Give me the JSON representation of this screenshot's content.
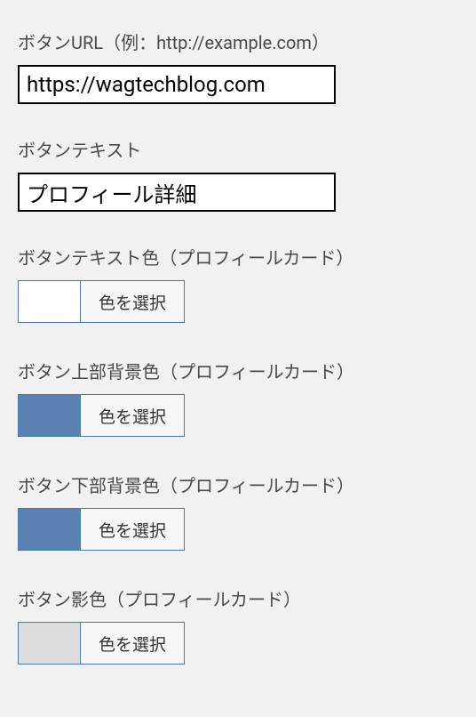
{
  "fields": {
    "url": {
      "label": "ボタンURL（例：http://example.com）",
      "value": "https://wagtechblog.com"
    },
    "text": {
      "label": "ボタンテキスト",
      "value": "プロフィール詳細"
    },
    "text_color": {
      "label": "ボタンテキスト色（プロフィールカード）",
      "swatch": "#ffffff",
      "button": "色を選択"
    },
    "bg_top": {
      "label": "ボタン上部背景色（プロフィールカード）",
      "swatch": "#5b82b2",
      "button": "色を選択"
    },
    "bg_bottom": {
      "label": "ボタン下部背景色（プロフィールカード）",
      "swatch": "#5b82b2",
      "button": "色を選択"
    },
    "shadow": {
      "label": "ボタン影色（プロフィールカード）",
      "swatch": "#dcdcdc",
      "button": "色を選択"
    }
  }
}
